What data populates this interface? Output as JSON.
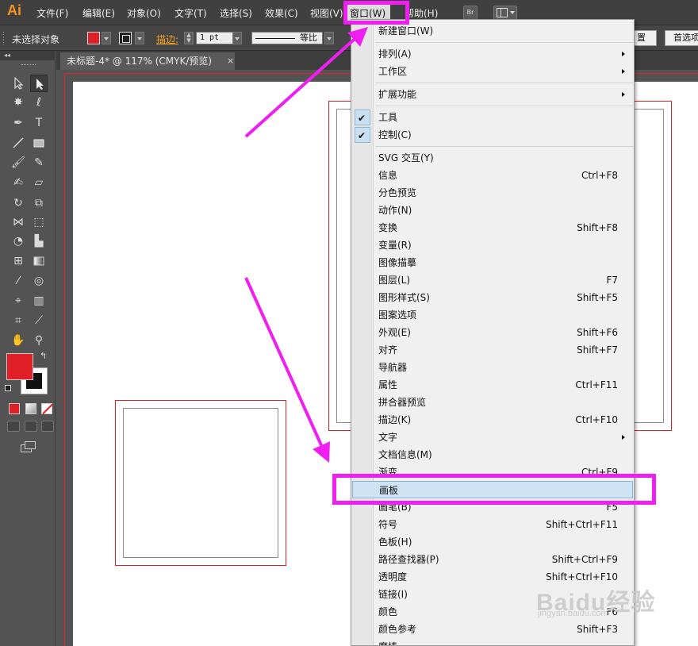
{
  "app": {
    "logo": "Ai"
  },
  "menubar": {
    "items": [
      {
        "label": "文件(F)"
      },
      {
        "label": "编辑(E)"
      },
      {
        "label": "对象(O)"
      },
      {
        "label": "文字(T)"
      },
      {
        "label": "选择(S)"
      },
      {
        "label": "效果(C)"
      },
      {
        "label": "视图(V)"
      },
      {
        "label": "窗口(W)"
      },
      {
        "label": "帮助(H)"
      }
    ],
    "bridge_label": "Br"
  },
  "control": {
    "no_selection": "未选择对象",
    "stroke_label": "描边:",
    "stroke_weight": "1 pt",
    "profile": "等比",
    "doc_setup": "置",
    "preferences": "首选项"
  },
  "document": {
    "tab_title": "未标题-4* @ 117% (CMYK/预览)",
    "close": "×"
  },
  "window_menu": {
    "items": [
      {
        "label": "新建窗口(W)"
      },
      {
        "label": "排列(A)",
        "submenu": true
      },
      {
        "label": "工作区",
        "submenu": true
      },
      {
        "label": "扩展功能",
        "submenu": true
      },
      {
        "label": "工具",
        "checked": true
      },
      {
        "label": "控制(C)",
        "checked": true
      },
      {
        "label": "SVG 交互(Y)"
      },
      {
        "label": "信息",
        "shortcut": "Ctrl+F8"
      },
      {
        "label": "分色预览"
      },
      {
        "label": "动作(N)"
      },
      {
        "label": "变换",
        "shortcut": "Shift+F8"
      },
      {
        "label": "变量(R)"
      },
      {
        "label": "图像描摹"
      },
      {
        "label": "图层(L)",
        "shortcut": "F7"
      },
      {
        "label": "图形样式(S)",
        "shortcut": "Shift+F5"
      },
      {
        "label": "图案选项"
      },
      {
        "label": "外观(E)",
        "shortcut": "Shift+F6"
      },
      {
        "label": "对齐",
        "shortcut": "Shift+F7"
      },
      {
        "label": "导航器"
      },
      {
        "label": "属性",
        "shortcut": "Ctrl+F11"
      },
      {
        "label": "拼合器预览"
      },
      {
        "label": "描边(K)",
        "shortcut": "Ctrl+F10"
      },
      {
        "label": "文字",
        "submenu": true
      },
      {
        "label": "文档信息(M)"
      },
      {
        "label": "渐变",
        "shortcut": "Ctrl+F9"
      },
      {
        "label": "画板",
        "highlighted": true
      },
      {
        "label": "画笔(B)",
        "shortcut": "F5"
      },
      {
        "label": "符号",
        "shortcut": "Shift+Ctrl+F11"
      },
      {
        "label": "色板(H)"
      },
      {
        "label": "路径查找器(P)",
        "shortcut": "Shift+Ctrl+F9"
      },
      {
        "label": "透明度",
        "shortcut": "Shift+Ctrl+F10"
      },
      {
        "label": "链接(I)"
      },
      {
        "label": "颜色",
        "shortcut": "F6"
      },
      {
        "label": "颜色参考",
        "shortcut": "Shift+F3"
      },
      {
        "label": "魔棒"
      }
    ]
  },
  "watermark": {
    "main": "Baidu经验",
    "sub": "jingyan.baidu.com"
  },
  "colors": {
    "fill": "#e01f26",
    "annotation": "#f01ef0",
    "accent": "#f7931e",
    "highlight": "#cfe3f5"
  }
}
